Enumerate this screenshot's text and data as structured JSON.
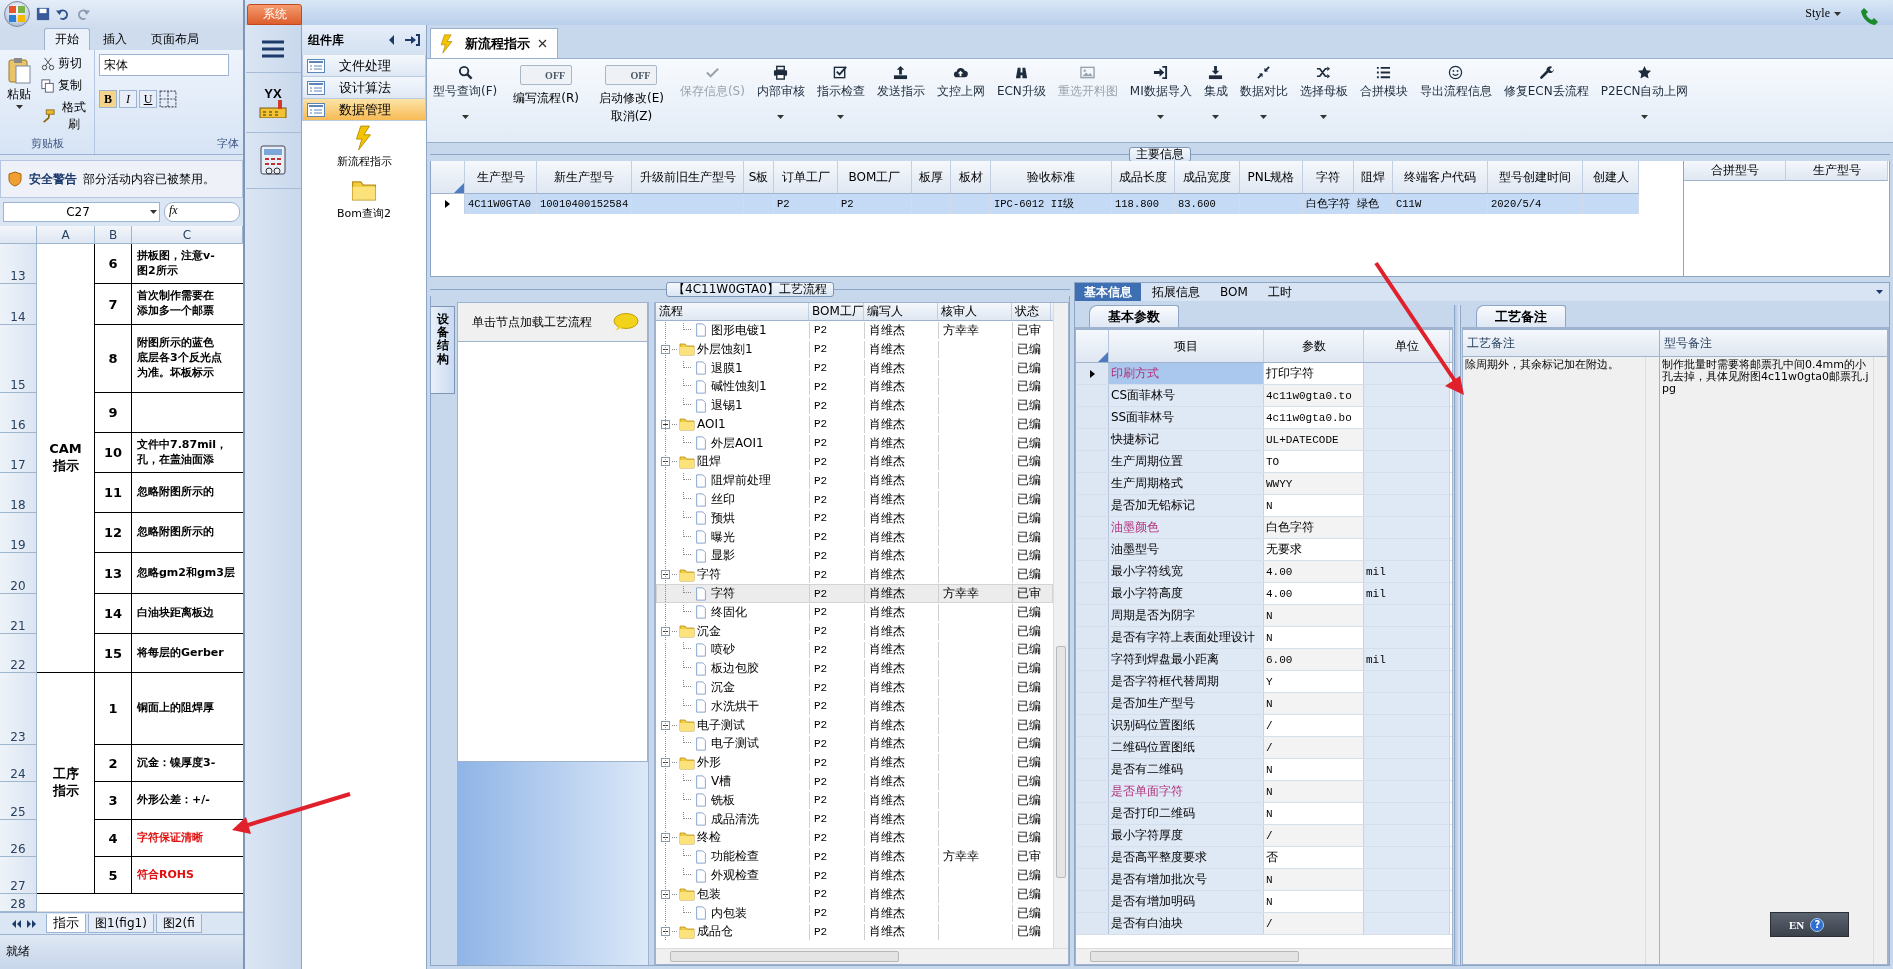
{
  "excel": {
    "ribbon_tabs": [
      {
        "label": "开始",
        "selected": true
      },
      {
        "label": "插入",
        "selected": false
      },
      {
        "label": "页面布局",
        "selected": false
      }
    ],
    "clipboard": {
      "paste": "粘贴",
      "cut": "剪切",
      "copy": "复制",
      "format_painter": "格式刷",
      "group_label": "剪贴板"
    },
    "font": {
      "font_name": "宋体",
      "bold": "B",
      "italic": "I",
      "underline": "U",
      "group_label": "字体"
    },
    "security_bar": {
      "title": "安全警告",
      "message": "部分活动内容已被禁用。"
    },
    "name_box": "C27",
    "formula_label": "fx",
    "sheet": {
      "columns": [
        "A",
        "B",
        "C"
      ],
      "groups": [
        {
          "label": "CAM指示",
          "rows": [
            {
              "row": "13",
              "number": "6",
              "lines": [
                "拼板图，注意v-",
                "图2所示"
              ],
              "color": "#000000"
            },
            {
              "row": "14",
              "number": "7",
              "lines": [
                "首次制作需要在",
                "添加多一个邮票"
              ],
              "color": "#000000"
            },
            {
              "row": "15",
              "number": "8",
              "lines": [
                "附图所示的蓝色",
                "底层各3个反光点",
                "为准。坏板标示"
              ],
              "color": "#000000"
            },
            {
              "row": "16",
              "number": "9"
            },
            {
              "row": "17",
              "number": "10",
              "lines": [
                "文件中7.87mil，",
                "孔，在盖油面添"
              ],
              "color": "#000000"
            },
            {
              "row": "18",
              "number": "11",
              "lines": [
                "忽略附图所示的"
              ],
              "color": "#000000"
            },
            {
              "row": "19",
              "number": "12",
              "lines": [
                "忽略附图所示的"
              ],
              "color": "#000000"
            },
            {
              "row": "20",
              "number": "13",
              "lines": [
                "忽略gm2和gm3层"
              ],
              "color": "#000000"
            },
            {
              "row": "21",
              "number": "14",
              "lines": [
                "白油块距离板边"
              ],
              "color": "#000000"
            },
            {
              "row": "22",
              "number": "15",
              "lines": [
                "将每层的Gerber"
              ],
              "color": "#000000"
            }
          ]
        },
        {
          "label": "工序指示",
          "rows": [
            {
              "row": "23",
              "number": "1",
              "lines": [
                "铜面上的阻焊厚"
              ],
              "color": "#000000"
            },
            {
              "row": "24",
              "number": "2",
              "lines": [
                "沉金：镍厚度3-"
              ],
              "color": "#000000"
            },
            {
              "row": "25",
              "number": "3",
              "lines": [
                "外形公差：+/-"
              ],
              "color": "#000000"
            },
            {
              "row": "26",
              "number": "4",
              "lines": [
                "字符保证清晰"
              ],
              "color": "#e01010"
            },
            {
              "row": "27",
              "number": "5",
              "lines": [
                "符合ROHS"
              ],
              "color": "#e01010"
            }
          ]
        }
      ],
      "trailing_rows": [
        "28"
      ]
    },
    "sheet_tabs": [
      {
        "label": "指示",
        "selected": true
      },
      {
        "label": "图1(fig1)",
        "selected": false
      },
      {
        "label": "图2(fi",
        "selected": false
      }
    ],
    "status": "就绪"
  },
  "app": {
    "system_button": "系统",
    "style_menu": "Style",
    "nav": {
      "logo_text": "YX"
    },
    "components": {
      "title": "组件库",
      "items": [
        {
          "label": "文件处理",
          "selected": false
        },
        {
          "label": "设计算法",
          "selected": false
        },
        {
          "label": "数据管理",
          "selected": true
        }
      ],
      "tools": [
        {
          "label": "新流程指示"
        },
        {
          "label": "Bom查询2"
        }
      ]
    },
    "doc_tabs": [
      {
        "label": "新流程指示",
        "selected": true
      }
    ],
    "toolbar": [
      {
        "kind": "button",
        "label": "型号查询(F)",
        "dropdown": true,
        "disabled": false
      },
      {
        "kind": "toggle",
        "label": "编写流程(R)",
        "state_text": "OFF",
        "on": false
      },
      {
        "kind": "toggle",
        "label": "启动修改(E)\n取消(Z)",
        "state_text": "OFF",
        "on": false
      },
      {
        "kind": "button",
        "label": "保存信息(S)",
        "dropdown": false,
        "disabled": true
      },
      {
        "kind": "button",
        "label": "内部审核",
        "dropdown": true,
        "disabled": false
      },
      {
        "kind": "button",
        "label": "指示检查",
        "dropdown": true,
        "disabled": false
      },
      {
        "kind": "button",
        "label": "发送指示",
        "dropdown": false,
        "disabled": false
      },
      {
        "kind": "button",
        "label": "文控上网",
        "dropdown": false,
        "disabled": false
      },
      {
        "kind": "button",
        "label": "ECN升级",
        "dropdown": false,
        "disabled": false
      },
      {
        "kind": "button",
        "label": "重选开料图",
        "dropdown": false,
        "disabled": true
      },
      {
        "kind": "button",
        "label": "MI数据导入",
        "dropdown": true,
        "disabled": false
      },
      {
        "kind": "button",
        "label": "集成",
        "dropdown": true,
        "disabled": false
      },
      {
        "kind": "button",
        "label": "数据对比",
        "dropdown": true,
        "disabled": false
      },
      {
        "kind": "button",
        "label": "选择母板",
        "dropdown": true,
        "disabled": false
      },
      {
        "kind": "button",
        "label": "合拼模块",
        "dropdown": false,
        "disabled": false
      },
      {
        "kind": "button",
        "label": "导出流程信息",
        "dropdown": false,
        "disabled": false
      },
      {
        "kind": "button",
        "label": "修复ECN丢流程",
        "dropdown": false,
        "disabled": false
      },
      {
        "kind": "button",
        "label": "P2ECN自动上网",
        "dropdown": true,
        "disabled": false
      }
    ],
    "main_info": {
      "title": "主要信息",
      "columns": [
        "生产型号",
        "新生产型号",
        "升级前旧生产型号",
        "S板",
        "订单工厂",
        "BOM工厂",
        "板厚",
        "板材",
        "验收标准",
        "成品长度",
        "成品宽度",
        "PNL规格",
        "字符",
        "阻焊",
        "终端客户代码",
        "型号创建时间",
        "创建人"
      ],
      "rows": [
        {
          "selected": true,
          "cells": [
            "4C11W0GTA0",
            "10010400152584",
            null,
            null,
            "P2",
            "P2",
            null,
            null,
            "IPC-6012 II级",
            "118.800",
            "83.600",
            null,
            "白色字符",
            "绿色",
            "C11W",
            "2020/5/4",
            null
          ]
        }
      ],
      "side_columns": [
        "合拼型号",
        "生产型号"
      ]
    },
    "side_tab": "设备结构",
    "node_panel": {
      "title": "单击节点加载工艺流程"
    },
    "flow_tree": {
      "title": "【4C11W0GTA0】工艺流程",
      "columns": [
        "流程",
        "BOM工厂",
        "编写人",
        "核审人",
        "状态"
      ],
      "nodes": [
        {
          "kind": "folder",
          "children": [
            {
              "kind": "leaf",
              "name": "图形电镀1",
              "factory": "P2",
              "writer": "肖维杰",
              "reviewer": "方幸幸",
              "status": "已审",
              "selected": false
            }
          ]
        },
        {
          "kind": "folder",
          "name": "外层蚀刻1",
          "factory": "P2",
          "writer": "肖维杰",
          "status": "已编",
          "expanded": true,
          "selected": false,
          "children": [
            {
              "kind": "leaf",
              "name": "退膜1",
              "factory": "P2",
              "writer": "肖维杰",
              "status": "已编",
              "selected": false
            },
            {
              "kind": "leaf",
              "name": "碱性蚀刻1",
              "factory": "P2",
              "writer": "肖维杰",
              "status": "已编",
              "selected": false
            },
            {
              "kind": "leaf",
              "name": "退锡1",
              "factory": "P2",
              "writer": "肖维杰",
              "status": "已编",
              "selected": false
            }
          ]
        },
        {
          "kind": "folder",
          "name": "AOI1",
          "factory": "P2",
          "writer": "肖维杰",
          "status": "已编",
          "expanded": true,
          "selected": false,
          "children": [
            {
              "kind": "leaf",
              "name": "外层AOI1",
              "factory": "P2",
              "writer": "肖维杰",
              "status": "已编",
              "selected": false
            }
          ]
        },
        {
          "kind": "folder",
          "name": "阻焊",
          "factory": "P2",
          "writer": "肖维杰",
          "status": "已编",
          "expanded": true,
          "selected": false,
          "children": [
            {
              "kind": "leaf",
              "name": "阻焊前处理",
              "factory": "P2",
              "writer": "肖维杰",
              "status": "已编",
              "selected": false
            },
            {
              "kind": "leaf",
              "name": "丝印",
              "factory": "P2",
              "writer": "肖维杰",
              "status": "已编",
              "selected": false
            },
            {
              "kind": "leaf",
              "name": "预烘",
              "factory": "P2",
              "writer": "肖维杰",
              "status": "已编",
              "selected": false
            },
            {
              "kind": "leaf",
              "name": "曝光",
              "factory": "P2",
              "writer": "肖维杰",
              "status": "已编",
              "selected": false
            },
            {
              "kind": "leaf",
              "name": "显影",
              "factory": "P2",
              "writer": "肖维杰",
              "status": "已编",
              "selected": false
            }
          ]
        },
        {
          "kind": "folder",
          "name": "字符",
          "factory": "P2",
          "writer": "肖维杰",
          "status": "已编",
          "expanded": true,
          "selected": false,
          "children": [
            {
              "kind": "leaf",
              "name": "字符",
              "factory": "P2",
              "writer": "肖维杰",
              "reviewer": "方幸幸",
              "status": "已审",
              "selected": true
            },
            {
              "kind": "leaf",
              "name": "终固化",
              "factory": "P2",
              "writer": "肖维杰",
              "status": "已编",
              "selected": false
            }
          ]
        },
        {
          "kind": "folder",
          "name": "沉金",
          "factory": "P2",
          "writer": "肖维杰",
          "status": "已编",
          "expanded": true,
          "selected": false,
          "children": [
            {
              "kind": "leaf",
              "name": "喷砂",
              "factory": "P2",
              "writer": "肖维杰",
              "status": "已编",
              "selected": false
            },
            {
              "kind": "leaf",
              "name": "板边包胶",
              "factory": "P2",
              "writer": "肖维杰",
              "status": "已编",
              "selected": false
            },
            {
              "kind": "leaf",
              "name": "沉金",
              "factory": "P2",
              "writer": "肖维杰",
              "status": "已编",
              "selected": false
            },
            {
              "kind": "leaf",
              "name": "水洗烘干",
              "factory": "P2",
              "writer": "肖维杰",
              "status": "已编",
              "selected": false
            }
          ]
        },
        {
          "kind": "folder",
          "name": "电子测试",
          "factory": "P2",
          "writer": "肖维杰",
          "status": "已编",
          "expanded": true,
          "selected": false,
          "children": [
            {
              "kind": "leaf",
              "name": "电子测试",
              "factory": "P2",
              "writer": "肖维杰",
              "status": "已编",
              "selected": false
            }
          ]
        },
        {
          "kind": "folder",
          "name": "外形",
          "factory": "P2",
          "writer": "肖维杰",
          "status": "已编",
          "expanded": true,
          "selected": false,
          "children": [
            {
              "kind": "leaf",
              "name": "V槽",
              "factory": "P2",
              "writer": "肖维杰",
              "status": "已编",
              "selected": false
            },
            {
              "kind": "leaf",
              "name": "铣板",
              "factory": "P2",
              "writer": "肖维杰",
              "status": "已编",
              "selected": false
            },
            {
              "kind": "leaf",
              "name": "成品清洗",
              "factory": "P2",
              "writer": "肖维杰",
              "status": "已编",
              "selected": false
            }
          ]
        },
        {
          "kind": "folder",
          "name": "终检",
          "factory": "P2",
          "writer": "肖维杰",
          "status": "已编",
          "expanded": true,
          "selected": false,
          "children": [
            {
              "kind": "leaf",
              "name": "功能检查",
              "factory": "P2",
              "writer": "肖维杰",
              "reviewer": "方幸幸",
              "status": "已审",
              "selected": false
            },
            {
              "kind": "leaf",
              "name": "外观检查",
              "factory": "P2",
              "writer": "肖维杰",
              "status": "已编",
              "selected": false
            }
          ]
        },
        {
          "kind": "folder",
          "name": "包装",
          "factory": "P2",
          "writer": "肖维杰",
          "status": "已编",
          "expanded": true,
          "selected": false,
          "children": [
            {
              "kind": "leaf",
              "name": "内包装",
              "factory": "P2",
              "writer": "肖维杰",
              "status": "已编",
              "selected": false
            }
          ]
        },
        {
          "kind": "folder",
          "name": "成品仓",
          "factory": "P2",
          "writer": "肖维杰",
          "status": "已编",
          "expanded": true,
          "selected": false
        }
      ]
    },
    "detail_tabs": [
      {
        "label": "基本信息",
        "selected": true
      },
      {
        "label": "拓展信息",
        "selected": false
      },
      {
        "label": "BOM",
        "selected": false
      },
      {
        "label": "工时",
        "selected": false
      }
    ],
    "params": {
      "tab": "基本参数",
      "columns": [
        "项目",
        "参数",
        "单位"
      ],
      "rows": [
        {
          "name": "印刷方式",
          "value": "打印字符",
          "emphasized": true,
          "selected": true
        },
        {
          "name": "CS面菲林号",
          "value": "4c11w0gta0.to",
          "emphasized": false,
          "selected": false
        },
        {
          "name": "SS面菲林号",
          "value": "4c11w0gta0.bo",
          "emphasized": false,
          "selected": false
        },
        {
          "name": "快捷标记",
          "value": "UL+DATECODE",
          "emphasized": false,
          "selected": false
        },
        {
          "name": "生产周期位置",
          "value": "TO",
          "emphasized": false,
          "selected": false
        },
        {
          "name": "生产周期格式",
          "value": "WWYY",
          "emphasized": false,
          "selected": false
        },
        {
          "name": "是否加无铅标记",
          "value": "N",
          "emphasized": false,
          "selected": false
        },
        {
          "name": "油墨颜色",
          "value": "白色字符",
          "emphasized": true,
          "selected": false
        },
        {
          "name": "油墨型号",
          "value": "无要求",
          "emphasized": false,
          "selected": false
        },
        {
          "name": "最小字符线宽",
          "value": "4.00",
          "unit": "mil",
          "emphasized": false,
          "selected": false
        },
        {
          "name": "最小字符高度",
          "value": "4.00",
          "unit": "mil",
          "emphasized": false,
          "selected": false
        },
        {
          "name": "周期是否为阴字",
          "value": "N",
          "emphasized": false,
          "selected": false
        },
        {
          "name": "是否有字符上表面处理设计",
          "value": "N",
          "emphasized": false,
          "selected": false
        },
        {
          "name": "字符到焊盘最小距离",
          "value": "6.00",
          "unit": "mil",
          "emphasized": false,
          "selected": false
        },
        {
          "name": "是否字符框代替周期",
          "value": "Y",
          "emphasized": false,
          "selected": false
        },
        {
          "name": "是否加生产型号",
          "value": "N",
          "emphasized": false,
          "selected": false
        },
        {
          "name": "识别码位置图纸",
          "value": "/",
          "emphasized": false,
          "selected": false
        },
        {
          "name": "二维码位置图纸",
          "value": "/",
          "emphasized": false,
          "selected": false
        },
        {
          "name": "是否有二维码",
          "value": "N",
          "emphasized": false,
          "selected": false
        },
        {
          "name": "是否单面字符",
          "value": "N",
          "emphasized": true,
          "selected": false
        },
        {
          "name": "是否打印二维码",
          "value": "N",
          "emphasized": false,
          "selected": false
        },
        {
          "name": "最小字符厚度",
          "value": "/",
          "emphasized": false,
          "selected": false
        },
        {
          "name": "是否高平整度要求",
          "value": "否",
          "emphasized": false,
          "selected": false
        },
        {
          "name": "是否有增加批次号",
          "value": "N",
          "emphasized": false,
          "selected": false
        },
        {
          "name": "是否有增加明码",
          "value": "N",
          "emphasized": false,
          "selected": false
        },
        {
          "name": "是否有白油块",
          "value": "/",
          "emphasized": false,
          "selected": false
        }
      ]
    },
    "notes": {
      "tab": "工艺备注",
      "columns": [
        {
          "header": "工艺备注",
          "text": "除周期外，其余标记加在附边。"
        },
        {
          "header": "型号备注",
          "text": "制作批量时需要将邮票孔中间0.4mm的小孔去掉，具体见附图4c11w0gta0邮票孔.jpg"
        }
      ]
    },
    "ime": {
      "language": "EN",
      "help": "?"
    }
  }
}
